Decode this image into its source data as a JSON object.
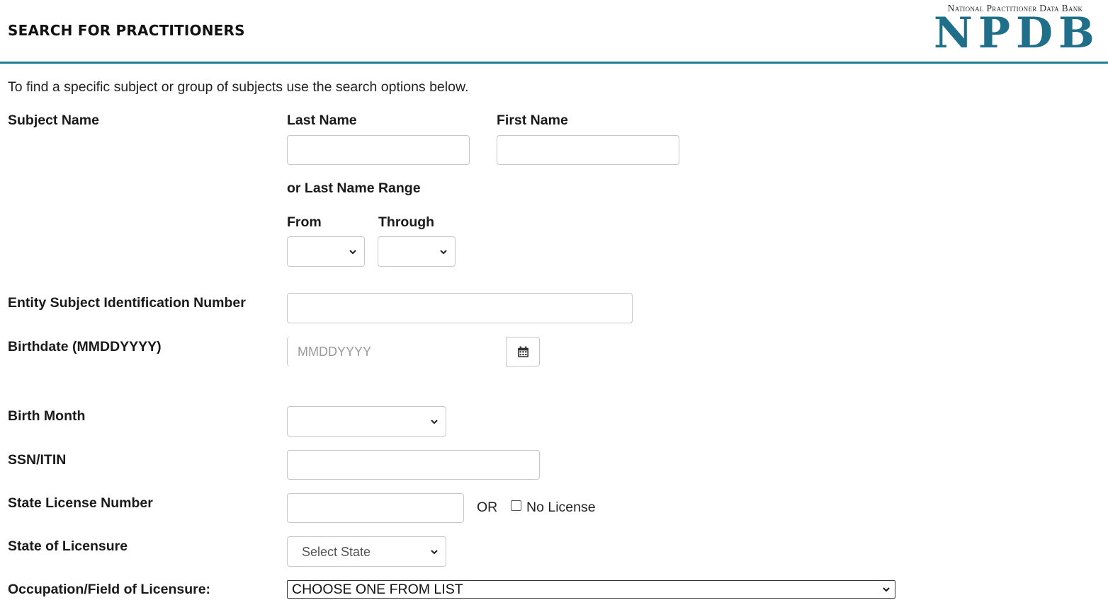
{
  "header": {
    "title": "SEARCH FOR PRACTITIONERS",
    "logo_subtitle": "National Practitioner Data Bank",
    "logo_main": "NPDB",
    "accent_color": "#1d7e91",
    "logo_color": "#1f6f8b"
  },
  "intro": "To find a specific subject or group of subjects use the search options below.",
  "form": {
    "subject_name_label": "Subject Name",
    "last_name_label": "Last Name",
    "last_name_value": "",
    "first_name_label": "First Name",
    "first_name_value": "",
    "range_label": "or Last Name Range",
    "from_label": "From",
    "from_value": "",
    "through_label": "Through",
    "through_value": "",
    "esin_label": "Entity Subject Identification Number",
    "esin_value": "",
    "birthdate_label": "Birthdate (MMDDYYYY)",
    "birthdate_placeholder": "MMDDYYYY",
    "birthdate_icon": "calendar-icon",
    "birth_month_label": "Birth Month",
    "birth_month_value": "",
    "ssn_label": "SSN/ITIN",
    "ssn_value": "",
    "license_label": "State License Number",
    "license_value": "",
    "or_text": "OR",
    "no_license_label": "No License",
    "no_license_checked": false,
    "state_label": "State of Licensure",
    "state_value": "Select State",
    "occupation_label": "Occupation/Field of Licensure:",
    "occupation_value": "CHOOSE ONE FROM LIST"
  }
}
